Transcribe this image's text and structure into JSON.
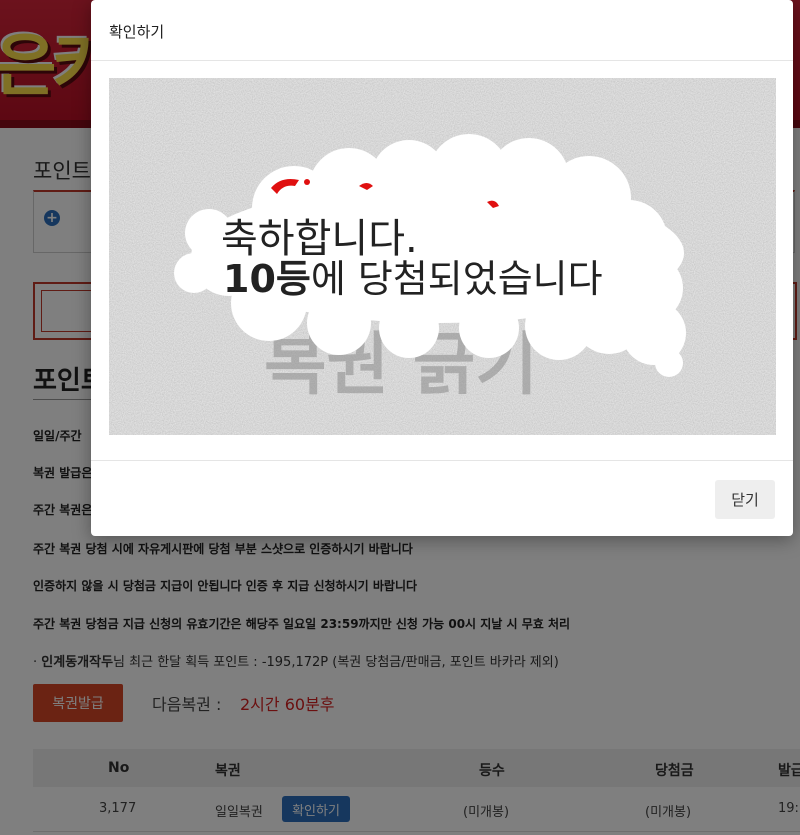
{
  "banner": {
    "logo_text": "은카"
  },
  "page": {
    "section_title_1": "포인트",
    "section_title_2": "포인트",
    "info_lines": [
      "일일/주간",
      "복권 발급은",
      "주간 복권은",
      "주간 복권 당첨 시에 자유게시판에 당첨 부분 스샷으로 인증하시기 바랍니다",
      "인증하지 않을 시 당첨금 지급이 안됩니다 인증 후 지급 신청하시기 바랍니다",
      "주간 복권 당첨금 지급 신청의 유효기간은 해당주 일요일 23:59까지만 신청 가능 00시 지날 시 무효 처리"
    ],
    "stat_bullet": "·",
    "stat_user": "인계동개작두",
    "stat_text": "님 최근 한달 획득 포인트 : -195,172P (복권 당첨금/판매금, 포인트 바카라 제외)",
    "issue_button": "복권발급",
    "next_label": "다음복권 :",
    "next_time": "2시간 60분후"
  },
  "table": {
    "headers": [
      "No",
      "복권",
      "등수",
      "당첨금",
      "발급"
    ],
    "rows": [
      {
        "no": "3,177",
        "type": "일일복권",
        "action": "확인하기",
        "rank": "(미개봉)",
        "prize": "(미개봉)",
        "issued": "19:"
      }
    ]
  },
  "modal": {
    "title": "확인하기",
    "scratch_line1": "축하합니다.",
    "scratch_rank": "10등",
    "scratch_line2_rest": "에 당첨되었습니다",
    "scratch_cover_text": "복권 긁기",
    "close_button": "닫기"
  },
  "colors": {
    "banner_red": "#c8182e",
    "accent_red": "#d64726",
    "link_blue": "#2c6fbd",
    "time_red": "#d62020"
  }
}
